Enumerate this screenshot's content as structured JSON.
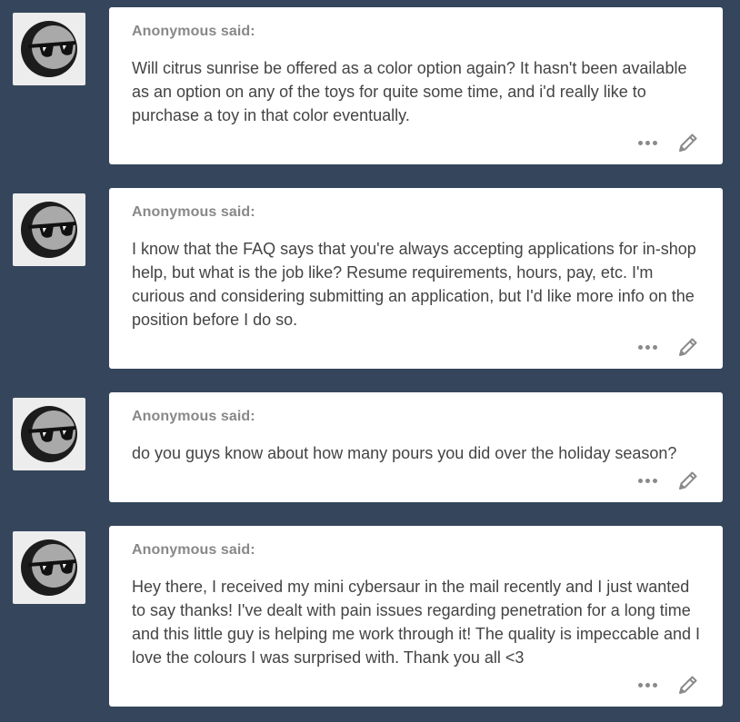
{
  "colors": {
    "background": "#35465c",
    "card": "#ffffff",
    "avatar_bg": "#ededed",
    "asker_text": "#888888",
    "question_text": "#444444",
    "icon": "#8a8a8a"
  },
  "icons": {
    "avatar": "sunglasses-moon-icon",
    "more": "more-dots-icon",
    "edit": "pencil-icon"
  },
  "posts": [
    {
      "asker": "Anonymous said:",
      "question": "Will citrus sunrise be offered as a color option again? It hasn't been available as an option on any of the toys for quite some time, and i'd really like to purchase a toy in that color eventually."
    },
    {
      "asker": "Anonymous said:",
      "question": "I know that the FAQ says that you're always accepting applications for in-shop help, but what is the job like? Resume requirements, hours, pay, etc. I'm curious and considering submitting an application, but I'd like more info on the position before I do so."
    },
    {
      "asker": "Anonymous said:",
      "question": "do you guys know about how many pours you did over the holiday season?"
    },
    {
      "asker": "Anonymous said:",
      "question": "Hey there, I received my mini cybersaur in the mail recently and I just wanted to say thanks! I've dealt with pain issues regarding penetration for a long time and this little guy is helping me work through it! The quality is impeccable and I love the colours I was surprised with. Thank you all <3"
    }
  ]
}
